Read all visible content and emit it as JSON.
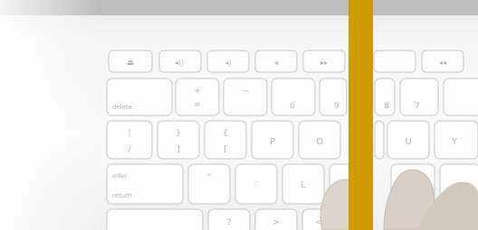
{
  "photo": {
    "subject": "keyboard-photo",
    "accent_color": "#d09a00",
    "top_bar_color": "#bdbdbd",
    "key_labels": {
      "delete": "delete",
      "enter": "enter",
      "return": "return",
      "plus": "+",
      "minus": "—",
      "equals": "=",
      "brace_open": "{",
      "brace_close": "}",
      "bracket_open": "[",
      "bracket_close": "]",
      "pipe": "|",
      "backslash": "/",
      "p": "P",
      "o": "O",
      "u": "U",
      "y": "Y",
      "l": "L",
      "k_quote": "\"",
      "k_semicolon": ":",
      "zero": "0",
      "nine": "9",
      "eight": "8",
      "seven": "7",
      "question": "?",
      "less": "<",
      "greater": ">"
    }
  }
}
